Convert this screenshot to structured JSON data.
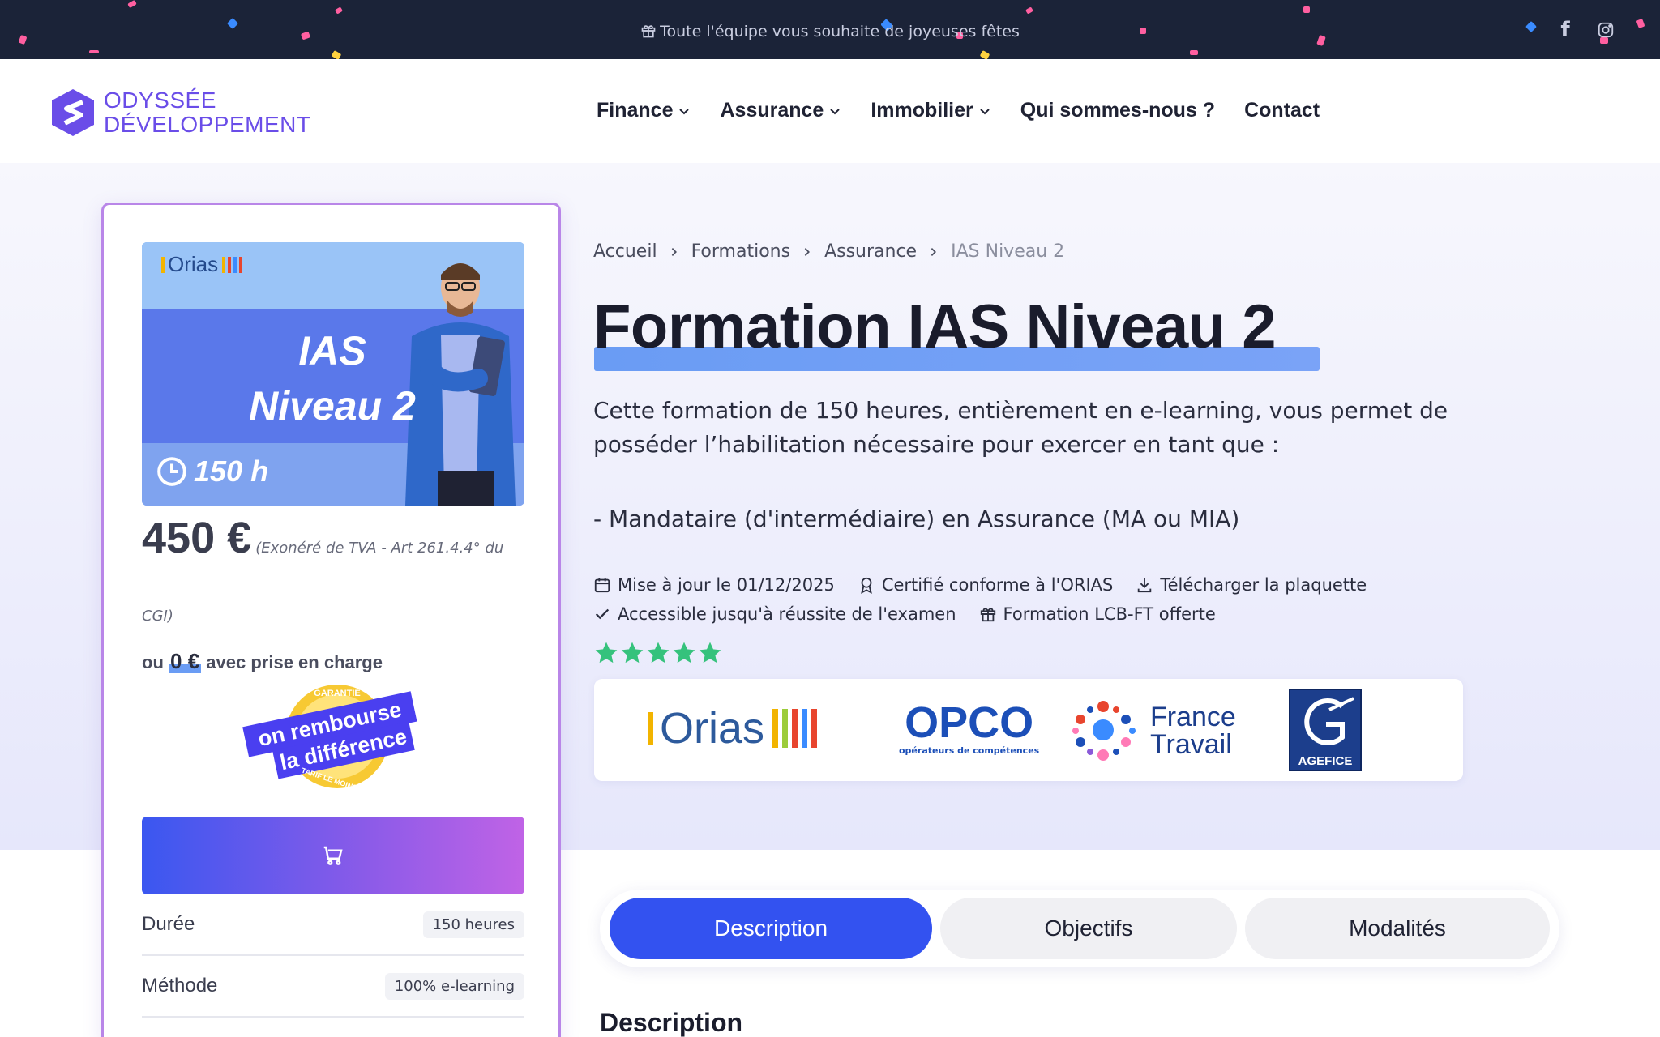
{
  "announcement": {
    "message": "Toute l'équipe vous souhaite de joyeuses fêtes"
  },
  "social": {
    "facebook": "f",
    "instagram_icon": "instagram-icon"
  },
  "brand": {
    "line1": "ODYSSÉE",
    "line2": "DÉVELOPPEMENT",
    "color": "#6a4de8"
  },
  "nav": {
    "items": [
      {
        "label": "Finance",
        "dropdown": true
      },
      {
        "label": "Assurance",
        "dropdown": true
      },
      {
        "label": "Immobilier",
        "dropdown": true
      },
      {
        "label": "Qui sommes-nous ?",
        "dropdown": false
      },
      {
        "label": "Contact",
        "dropdown": false
      }
    ]
  },
  "card": {
    "promo": {
      "brand": "Orias",
      "title_line1": "IAS",
      "title_line2": "Niveau 2",
      "hours": "150 h"
    },
    "price": "450 €",
    "vat_note": "(Exonéré de TVA - Art 261.4.4° du CGI)",
    "funding": {
      "prefix": "ou",
      "amount": "0 €",
      "suffix": "avec prise en charge"
    },
    "badge": {
      "top": "GARANTIE",
      "line1": "on rembourse",
      "line2": "la différence",
      "bottom": "TARIF LE MOINS CHER"
    },
    "specs": [
      {
        "key": "Durée",
        "value": "150 heures"
      },
      {
        "key": "Méthode",
        "value": "100% e-learning"
      }
    ]
  },
  "breadcrumb": {
    "items": [
      "Accueil",
      "Formations",
      "Assurance"
    ],
    "current": "IAS Niveau 2"
  },
  "page": {
    "title": "Formation IAS Niveau 2",
    "lead": "Cette formation de 150 heures, entièrement en e-learning, vous permet de posséder l’habilitation nécessaire pour exercer en tant que :",
    "bullet": "- Mandataire (d'intermédiaire) en Assurance (MA ou MIA)",
    "meta_row1": [
      "Mise à jour le 01/12/2025",
      "Certifié conforme à l'ORIAS",
      "Télécharger la plaquette"
    ],
    "meta_row2": [
      "Accessible jusqu'à réussite de l'examen",
      "Formation LCB-FT offerte"
    ],
    "rating": 5,
    "rating_color": "#35c27c"
  },
  "partners": {
    "orias": "Orias",
    "opco": "OPCO",
    "opco_sub": "opérateurs de compétences",
    "france_travail_1": "France",
    "france_travail_2": "Travail",
    "agefice": "AGEFICE"
  },
  "tabs": [
    {
      "label": "Description",
      "active": true
    },
    {
      "label": "Objectifs",
      "active": false
    },
    {
      "label": "Modalités",
      "active": false
    }
  ],
  "section": {
    "title": "Description"
  },
  "colors": {
    "accent": "#3352f0",
    "dark": "#1b2338",
    "purple": "#b986e8"
  }
}
